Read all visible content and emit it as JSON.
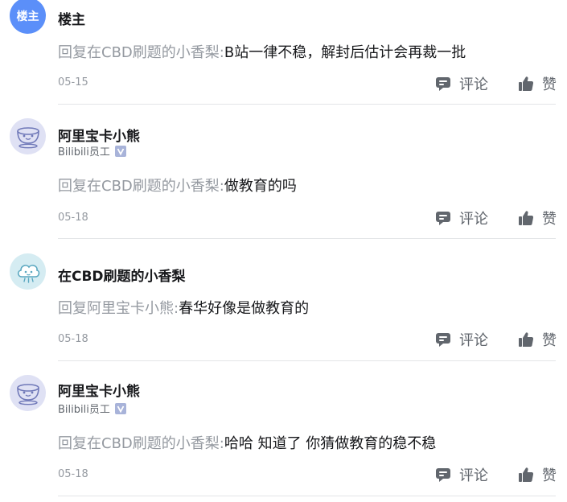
{
  "actions": {
    "comment_label": "评论",
    "like_label": "赞"
  },
  "replies": [
    {
      "avatar_text": "楼主",
      "name": "楼主",
      "role": "",
      "reply_prefix": "回复在CBD刷题的小香梨:",
      "reply_text": "B站一律不稳，解封后估计会再裁一批",
      "date": "05-15"
    },
    {
      "name": "阿里宝卡小熊",
      "role": "Bilibili员工",
      "reply_prefix": "回复在CBD刷题的小香梨:",
      "reply_text": "做教育的吗",
      "date": "05-18"
    },
    {
      "name": "在CBD刷题的小香梨",
      "role": "",
      "reply_prefix": "回复阿里宝卡小熊:",
      "reply_text": "春华好像是做教育的",
      "date": "05-18"
    },
    {
      "name": "阿里宝卡小熊",
      "role": "Bilibili员工",
      "reply_prefix": "回复在CBD刷题的小香梨:",
      "reply_text": "哈哈 知道了 你猜做教育的稳不稳",
      "date": "05-18"
    }
  ]
}
